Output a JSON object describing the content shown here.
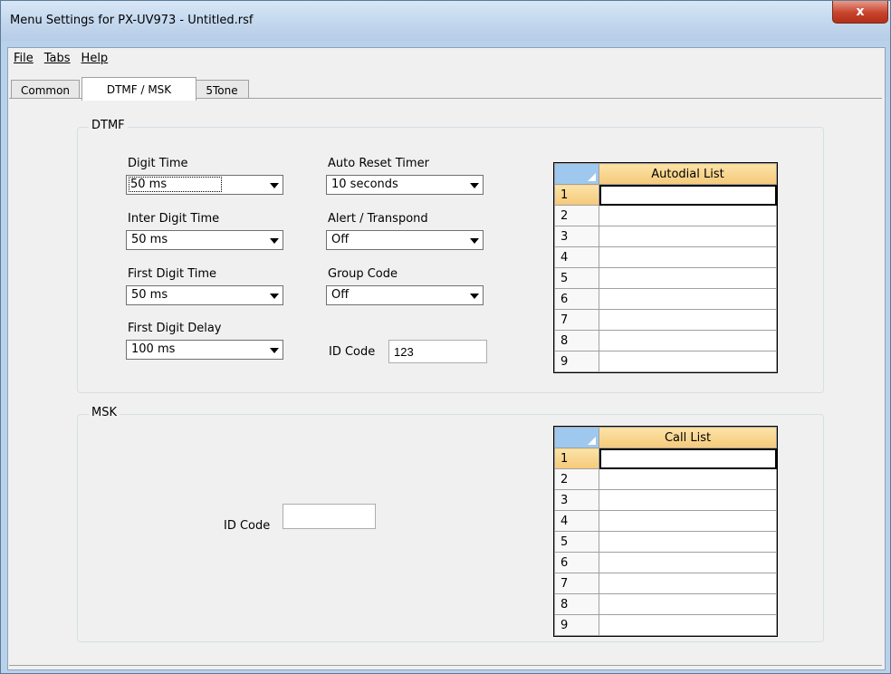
{
  "window": {
    "title": "Menu Settings for PX-UV973 - Untitled.rsf",
    "close_label": "x"
  },
  "menu": {
    "file": "File",
    "tabs": "Tabs",
    "help": "Help"
  },
  "tabs": [
    "Common",
    "DTMF / MSK",
    "5Tone"
  ],
  "active_tab": "DTMF / MSK",
  "dtmf": {
    "title": "DTMF",
    "digit_time": {
      "label": "Digit Time",
      "value": "50 ms"
    },
    "inter_digit_time": {
      "label": "Inter Digit Time",
      "value": "50 ms"
    },
    "first_digit_time": {
      "label": "First Digit Time",
      "value": "50 ms"
    },
    "first_digit_delay": {
      "label": "First Digit Delay",
      "value": "100 ms"
    },
    "auto_reset_timer": {
      "label": "Auto Reset Timer",
      "value": "10 seconds"
    },
    "alert_transpond": {
      "label": "Alert / Transpond",
      "value": "Off"
    },
    "group_code": {
      "label": "Group Code",
      "value": "Off"
    },
    "id_code": {
      "label": "ID Code",
      "value": "123"
    },
    "autodial": {
      "header": "Autodial List",
      "rows": [
        "1",
        "2",
        "3",
        "4",
        "5",
        "6",
        "7",
        "8",
        "9"
      ],
      "values": [
        "",
        "",
        "",
        "",
        "",
        "",
        "",
        "",
        ""
      ]
    }
  },
  "msk": {
    "title": "MSK",
    "id_code": {
      "label": "ID Code",
      "value": ""
    },
    "call_list": {
      "header": "Call List",
      "rows": [
        "1",
        "2",
        "3",
        "4",
        "5",
        "6",
        "7",
        "8",
        "9"
      ],
      "values": [
        "",
        "",
        "",
        "",
        "",
        "",
        "",
        "",
        ""
      ]
    }
  },
  "colors": {
    "grid_header": "#f5c97a",
    "grid_corner": "#9ec8ee",
    "close": "#c7432c"
  }
}
